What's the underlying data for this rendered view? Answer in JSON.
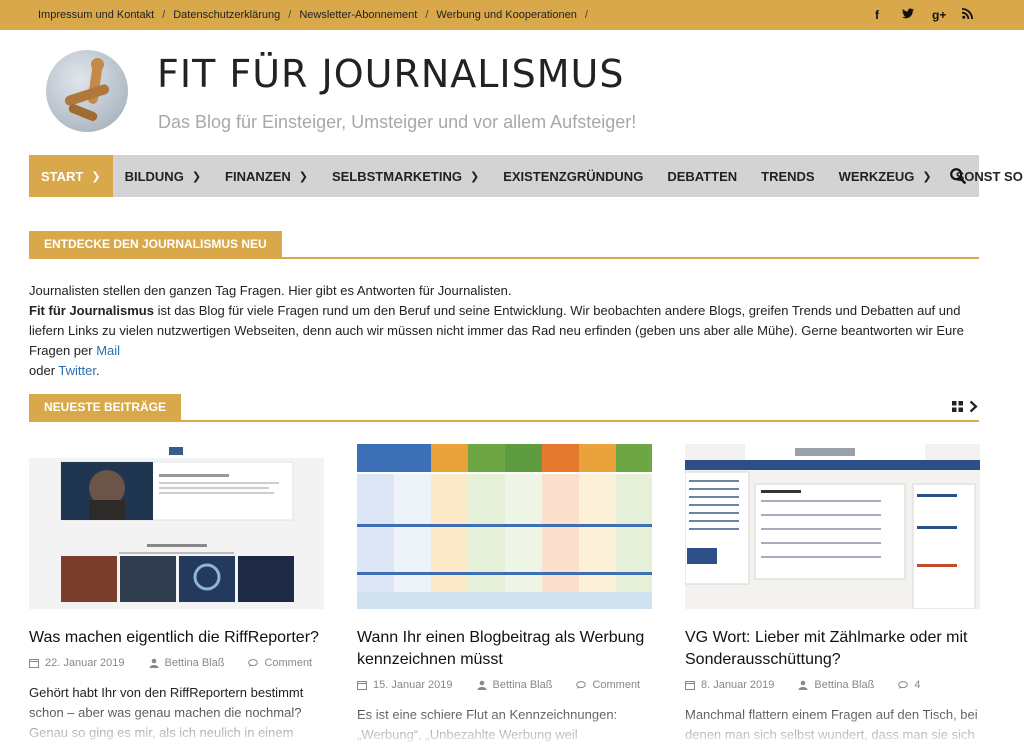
{
  "topbar": {
    "links": [
      "Impressum und Kontakt",
      "Datenschutzerklärung",
      "Newsletter-Abonnement",
      "Werbung und Kooperationen"
    ],
    "social": [
      "facebook-icon",
      "twitter-icon",
      "google-plus-icon",
      "rss-icon"
    ]
  },
  "header": {
    "title": "FIT FÜR JOURNALISMUS",
    "tagline": "Das Blog für Einsteiger, Umsteiger und vor allem Aufsteiger!"
  },
  "nav": {
    "items": [
      {
        "label": "START",
        "has_children": true
      },
      {
        "label": "BILDUNG",
        "has_children": true
      },
      {
        "label": "FINANZEN",
        "has_children": true
      },
      {
        "label": "SELBSTMARKETING",
        "has_children": true
      },
      {
        "label": "EXISTENZGRÜNDUNG",
        "has_children": false
      },
      {
        "label": "DEBATTEN",
        "has_children": false
      },
      {
        "label": "TRENDS",
        "has_children": false
      },
      {
        "label": "WERKZEUG",
        "has_children": true
      },
      {
        "label": "SONST SO",
        "has_children": false
      }
    ]
  },
  "intro": {
    "heading": "ENTDECKE DEN JOURNALISMUS NEU",
    "line1": "Journalisten stellen den ganzen Tag Fragen. Hier gibt es Antworten für Journalisten.",
    "bold": "Fit für Journalismus",
    "line2": " ist das Blog für viele Fragen rund um den Beruf und seine Entwicklung. Wir beobachten andere Blogs, greifen Trends und Debatten auf und liefern Links zu vielen nutzwertigen Webseiten, denn auch wir müssen nicht immer das Rad neu erfinden (geben uns aber alle Mühe). Gerne beantworten wir Eure Fragen per ",
    "mail_link": "Mail",
    "or": " oder ",
    "twitter_link": "Twitter",
    "end": "."
  },
  "posts_section": {
    "heading": "NEUESTE BEITRÄGE"
  },
  "posts": [
    {
      "title": "Was machen eigentlich die RiffReporter?",
      "date": "22. Januar 2019",
      "author": "Bettina Blaß",
      "comments": "Comment",
      "excerpt": "Gehört habt Ihr von den RiffReportern bestimmt schon – aber was genau machen die nochmal? Genau so ging es mir, als ich neulich in einem"
    },
    {
      "title": "Wann Ihr einen Blogbeitrag als Werbung kennzeichnen müsst",
      "date": "15. Januar 2019",
      "author": "Bettina Blaß",
      "comments": "Comment",
      "excerpt": "Es ist eine schiere Flut an Kennzeichnungen: „Werbung“, „Unbezahlte Werbung weil"
    },
    {
      "title": "VG Wort: Lieber mit Zählmarke oder mit Sonderausschüttung?",
      "date": "8. Januar 2019",
      "author": "Bettina Blaß",
      "comments": "4",
      "excerpt": "Manchmal flattern einem Fragen auf den Tisch, bei denen man sich selbst wundert, dass man sie sich"
    }
  ],
  "colors": {
    "accent": "#d8a84a",
    "nav_bg": "#d4d3d3",
    "link": "#2a6fb3"
  }
}
